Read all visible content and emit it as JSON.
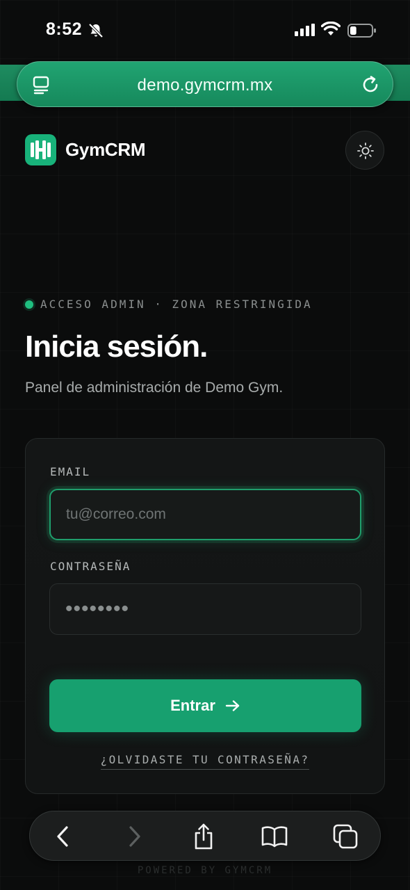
{
  "status_bar": {
    "time": "8:52",
    "battery_level": 0.3
  },
  "browser": {
    "url": "demo.gymcrm.mx",
    "toolbar_icons": [
      "back-icon",
      "forward-icon",
      "share-icon",
      "bookmarks-icon",
      "tabs-icon"
    ]
  },
  "header": {
    "brand": "GymCRM",
    "logo_icon": "dumbbell-icon",
    "theme_icon": "sun-icon"
  },
  "hero": {
    "eyebrow": "ACCESO ADMIN · ZONA RESTRINGIDA",
    "title": "Inicia sesión.",
    "subtitle": "Panel de administración de Demo Gym."
  },
  "form": {
    "email_label": "EMAIL",
    "email_placeholder": "tu@correo.com",
    "password_label": "CONTRASEÑA",
    "password_placeholder": "••••••••",
    "submit_label": "Entrar",
    "forgot_label": "¿OLVIDASTE TU CONTRASEÑA?"
  },
  "footer": {
    "powered": "POWERED BY GYMCRM"
  },
  "colors": {
    "accent": "#17a06f",
    "background": "#0b0c0c",
    "card": "#141616",
    "url_bar": "#1a9566"
  }
}
